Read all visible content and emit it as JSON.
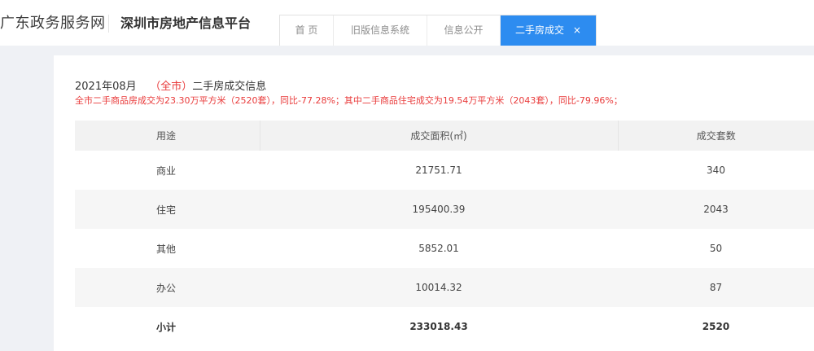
{
  "header": {
    "gov_site": "广东政务服务网",
    "platform_title": "深圳市房地产信息平台"
  },
  "nav": {
    "tabs": [
      {
        "label": "首 页"
      },
      {
        "label": "旧版信息系统"
      },
      {
        "label": "信息公开"
      },
      {
        "label": "二手房成交",
        "active": true,
        "close": "×"
      }
    ]
  },
  "report": {
    "period": "2021年08月",
    "region_open": "（",
    "region": "全市",
    "region_close": "）",
    "title_suffix": "二手房成交信息",
    "summary": "全市二手商品房成交为23.30万平方米（2520套），同比-77.28%；其中二手商品住宅成交为19.54万平方米（2043套），同比-79.96%；"
  },
  "table": {
    "headers": [
      "用途",
      "成交面积(㎡)",
      "成交套数"
    ],
    "rows": [
      {
        "use": "商业",
        "area": "21751.71",
        "count": "340"
      },
      {
        "use": "住宅",
        "area": "195400.39",
        "count": "2043"
      },
      {
        "use": "其他",
        "area": "5852.01",
        "count": "50"
      },
      {
        "use": "办公",
        "area": "10014.32",
        "count": "87"
      }
    ],
    "total": {
      "use": "小计",
      "area": "233018.43",
      "count": "2520"
    }
  },
  "colors": {
    "accent": "#2d8cf0",
    "highlight": "#e93b3b"
  }
}
